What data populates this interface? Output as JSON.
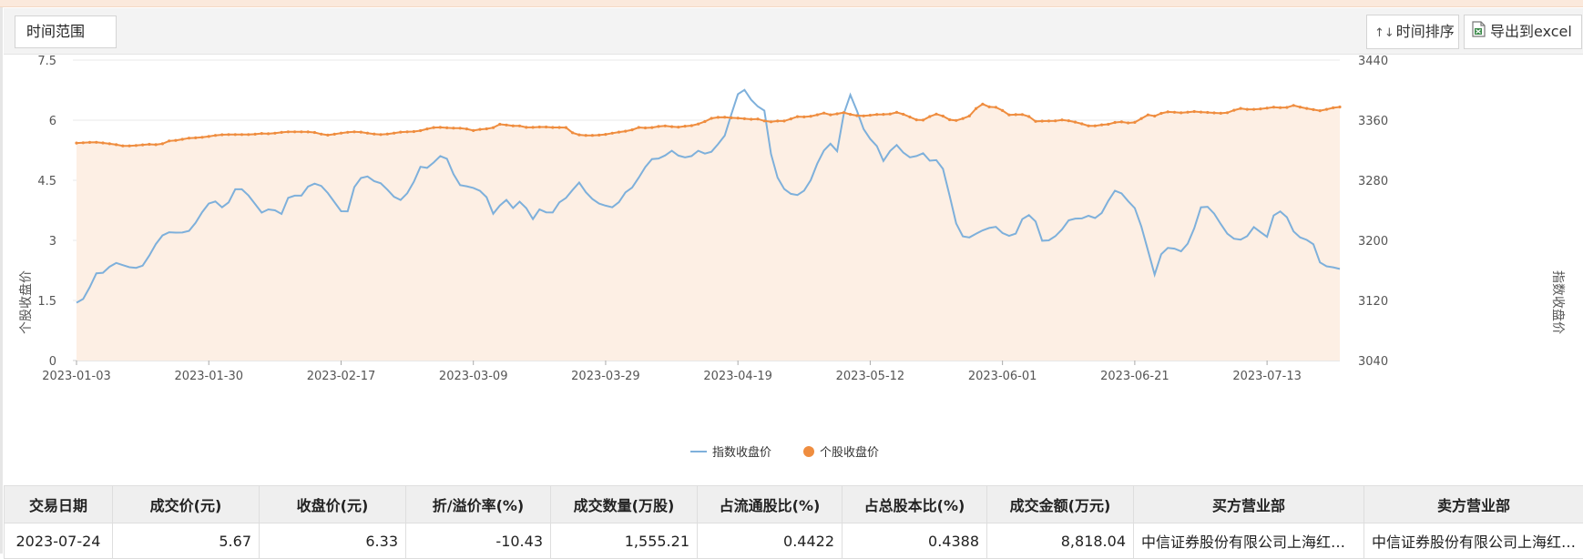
{
  "toolbar": {
    "range_label": "时间范围",
    "sort_label": "时间排序",
    "sort_icon": "sort-arrows-icon",
    "export_label": "导出到excel",
    "export_icon": "excel-file-icon"
  },
  "chart_data": {
    "type": "line",
    "y_left": {
      "label": "个股收盘价",
      "min": 0,
      "max": 7.5,
      "ticks": [
        "0",
        "1.5",
        "3",
        "4.5",
        "6",
        "7.5"
      ]
    },
    "y_right": {
      "label": "指数收盘价",
      "min": 3040,
      "max": 3440,
      "ticks": [
        "3040",
        "3120",
        "3200",
        "3280",
        "3360",
        "3440"
      ]
    },
    "x_ticks": [
      "2023-01-03",
      "2023-01-30",
      "2023-02-17",
      "2023-03-09",
      "2023-03-29",
      "2023-04-19",
      "2023-05-12",
      "2023-06-01",
      "2023-06-21",
      "2023-07-13"
    ],
    "x_tick_index": [
      0,
      20,
      40,
      60,
      80,
      100,
      120,
      140,
      160,
      180
    ],
    "point_count": 192,
    "grid": true,
    "legend_position": "bottom",
    "colors": {
      "index": "#7eb0db",
      "stock": "#ef8d3f",
      "area": "#fdefe4"
    },
    "series": [
      {
        "name": "指数收盘价",
        "axis": "right",
        "values": [
          3117,
          3124,
          3156,
          3157,
          3171,
          3167,
          3163,
          3164,
          3183,
          3205,
          3211,
          3210,
          3211,
          3226,
          3248,
          3252,
          3240,
          3268,
          3268,
          3252,
          3236,
          3244,
          3233,
          3263,
          3256,
          3273,
          3277,
          3264,
          3247,
          3230,
          3275,
          3288,
          3279,
          3275,
          3259,
          3253,
          3269,
          3298,
          3296,
          3313,
          3308,
          3274,
          3272,
          3269,
          3262,
          3231,
          3258,
          3243,
          3255,
          3226,
          3244,
          3232,
          3251,
          3259,
          3279,
          3261,
          3250,
          3246,
          3243,
          3263,
          3272,
          3294,
          3309,
          3309,
          3320,
          3311,
          3310,
          3320,
          3313,
          3327,
          3343,
          3393,
          3401,
          3379,
          3377,
          3296,
          3270,
          3261,
          3260,
          3279,
          3310,
          3331,
          3317,
          3403,
          3373,
          3339,
          3330,
          3302,
          3331,
          3317,
          3308,
          3318,
          3304,
          3309,
          3259,
          3207,
          3203,
          3210,
          3216,
          3218,
          3206,
          3206,
          3233,
          3234,
          3198,
          3201,
          3213,
          3230,
          3228,
          3233,
          3228,
          3251,
          3270,
          3255,
          3242,
          3205,
          3152,
          3190,
          3190,
          3185,
          3202,
          3244,
          3245,
          3225,
          3207,
          3199,
          3205,
          3222,
          3198,
          3238,
          3239,
          3212,
          3201,
          3200,
          3166,
          3165,
          3162
        ]
      },
      {
        "name": "个股收盘价",
        "axis": "left",
        "values": [
          5.43,
          5.44,
          5.45,
          5.43,
          5.4,
          5.36,
          5.36,
          5.38,
          5.4,
          5.38,
          5.48,
          5.5,
          5.55,
          5.56,
          5.58,
          5.62,
          5.64,
          5.64,
          5.64,
          5.64,
          5.67,
          5.66,
          5.69,
          5.71,
          5.71,
          5.71,
          5.69,
          5.62,
          5.65,
          5.69,
          5.71,
          5.7,
          5.66,
          5.64,
          5.66,
          5.7,
          5.71,
          5.72,
          5.78,
          5.83,
          5.81,
          5.8,
          5.8,
          5.74,
          5.78,
          5.79,
          5.91,
          5.86,
          5.86,
          5.81,
          5.83,
          5.83,
          5.81,
          5.83,
          5.65,
          5.62,
          5.62,
          5.63,
          5.67,
          5.71,
          5.74,
          5.82,
          5.8,
          5.84,
          5.86,
          5.82,
          5.85,
          5.87,
          5.95,
          6.06,
          6.08,
          6.06,
          6.05,
          6.02,
          6.03,
          5.95,
          5.98,
          5.98,
          6.09,
          6.08,
          6.11,
          6.18,
          6.12,
          6.2,
          6.14,
          6.1,
          6.12,
          6.15,
          6.14,
          6.2,
          6.12,
          6.01,
          6.0,
          6.17,
          6.1,
          5.97,
          6.03,
          6.12,
          6.43,
          6.33,
          6.32,
          6.13,
          6.14,
          6.14,
          5.97,
          5.98,
          5.98,
          6.01,
          5.97,
          5.91,
          5.84,
          5.88,
          5.9,
          5.97,
          5.93,
          5.95,
          6.14,
          6.1,
          6.21,
          6.2,
          6.18,
          6.22,
          6.2,
          6.19,
          6.17,
          6.19,
          6.3,
          6.27,
          6.27,
          6.3,
          6.33,
          6.3,
          6.37,
          6.31,
          6.27,
          6.23,
          6.3,
          6.33
        ]
      }
    ]
  },
  "table": {
    "headers": [
      "交易日期",
      "成交价(元)",
      "收盘价(元)",
      "折/溢价率(%)",
      "成交数量(万股)",
      "占流通股比(%)",
      "占总股本比(%)",
      "成交金额(万元)",
      "买方营业部",
      "卖方营业部"
    ],
    "rows": [
      [
        "2023-07-24",
        "5.67",
        "6.33",
        "-10.43",
        "1,555.21",
        "0.4422",
        "0.4388",
        "8,818.04",
        "中信证券股份有限公司上海红…",
        "中信证券股份有限公司上海红…"
      ]
    ]
  }
}
